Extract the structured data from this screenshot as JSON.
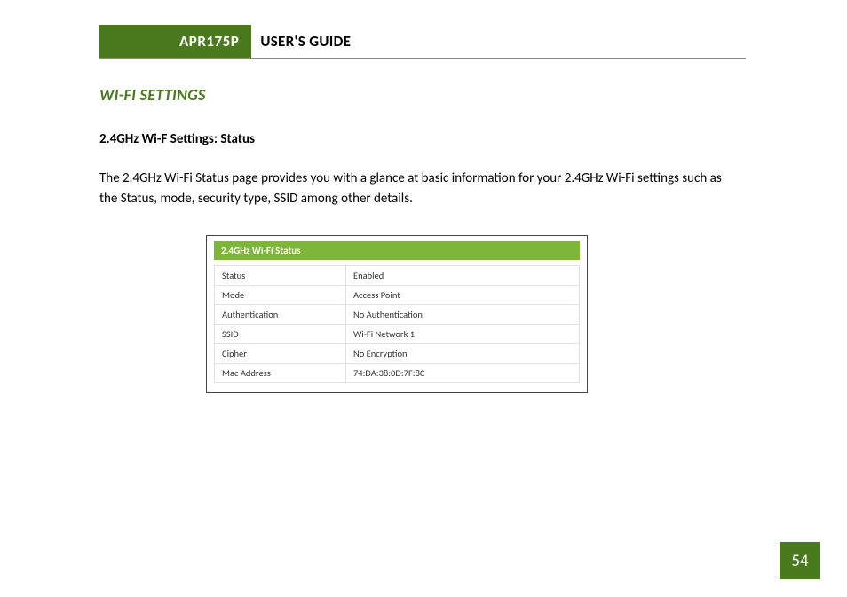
{
  "header": {
    "model": "APR175P",
    "title": "USER'S GUIDE"
  },
  "section": {
    "title": "WI-FI SETTINGS",
    "subtitle": "2.4GHz Wi-F Settings: Status",
    "body": "The 2.4GHz Wi-Fi Status page provides you with a glance at basic information for your 2.4GHz Wi-Fi settings such as the Status, mode, security type, SSID among other details."
  },
  "figure": {
    "header": "2.4GHz Wi-Fi Status",
    "rows": [
      {
        "label": "Status",
        "value": "Enabled"
      },
      {
        "label": "Mode",
        "value": "Access Point"
      },
      {
        "label": "Authentication",
        "value": "No Authentication"
      },
      {
        "label": "SSID",
        "value": "Wi-Fi Network 1"
      },
      {
        "label": "Cipher",
        "value": "No Encryption"
      },
      {
        "label": "Mac Address",
        "value": "74:DA:38:0D:7F:8C"
      }
    ]
  },
  "page_number": "54"
}
